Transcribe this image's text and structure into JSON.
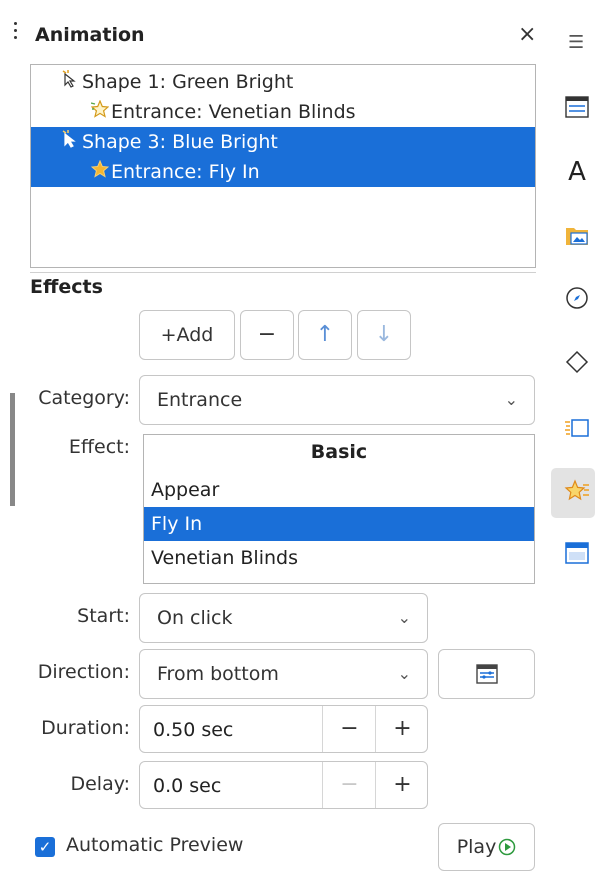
{
  "panel": {
    "title": "Animation"
  },
  "tree": {
    "items": [
      {
        "label": "Shape 1: Green Bright",
        "icon": "cursor-icon",
        "selected": false,
        "indent": 1
      },
      {
        "label": "Entrance: Venetian Blinds",
        "icon": "star-icon",
        "selected": false,
        "indent": 2
      },
      {
        "label": "Shape 3: Blue Bright",
        "icon": "cursor-icon",
        "selected": true,
        "indent": 1
      },
      {
        "label": "Entrance: Fly In",
        "icon": "star-icon",
        "selected": true,
        "indent": 2
      }
    ]
  },
  "effects": {
    "heading": "Effects",
    "add_label": "+Add",
    "remove_label": "−",
    "up_label": "↑",
    "down_label": "↓",
    "category_label": "Category:",
    "category_value": "Entrance",
    "effect_label": "Effect:",
    "effect_group": "Basic",
    "effect_items": [
      "Appear",
      "Fly In",
      "Venetian Blinds"
    ],
    "effect_selected": "Fly In",
    "start_label": "Start:",
    "start_value": "On click",
    "direction_label": "Direction:",
    "direction_value": "From bottom",
    "duration_label": "Duration:",
    "duration_value": "0.50 sec",
    "delay_label": "Delay:",
    "delay_value": "0.0 sec",
    "minus": "−",
    "plus": "+",
    "auto_preview_label": "Automatic Preview",
    "auto_preview_checked": true,
    "play_label": "Play"
  },
  "colors": {
    "selection": "#1a6fd8",
    "accent_icon": "#1a6fd8"
  }
}
